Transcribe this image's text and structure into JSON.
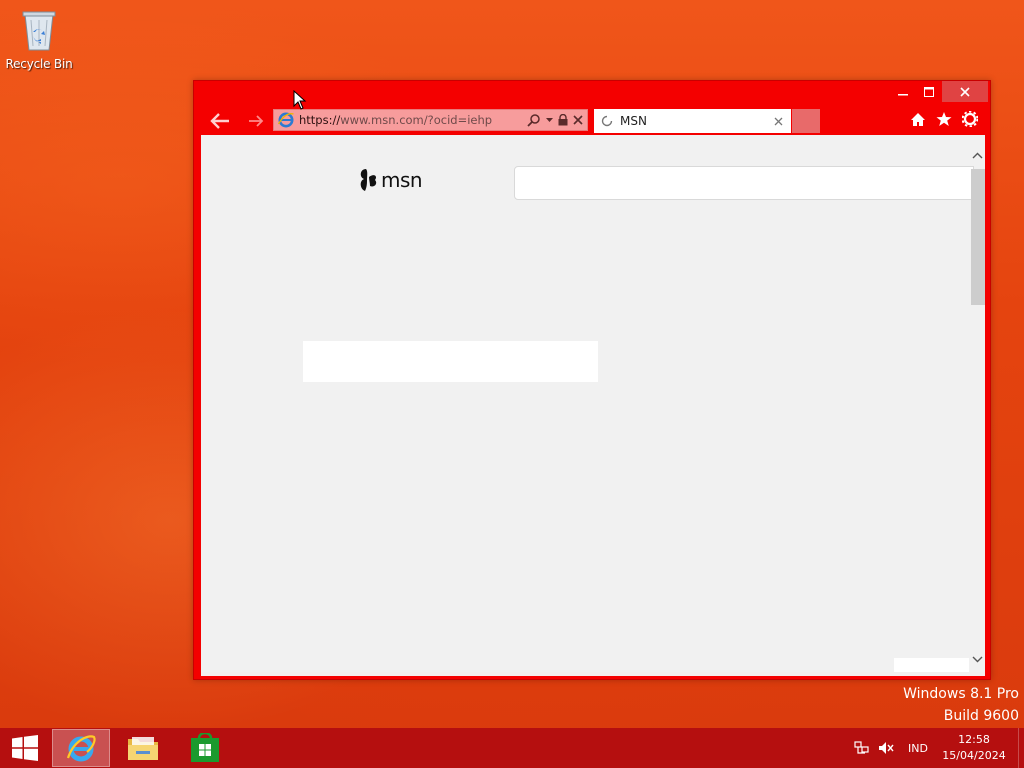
{
  "desktop": {
    "icons": [
      {
        "label": "Recycle Bin",
        "icon": "recycle-bin-icon"
      }
    ]
  },
  "browser": {
    "address_url_prefix": "https://",
    "address_url_host": "www.msn.com",
    "address_url_rest": "/?ocid=iehp",
    "tab_title": "MSN",
    "tab_loading": true,
    "page": {
      "logo_text": "msn",
      "search_value": ""
    }
  },
  "watermark": {
    "line1": "Windows 8.1 Pro",
    "line2": "Build 9600"
  },
  "taskbar": {
    "pinned": [
      "internet-explorer-icon",
      "file-explorer-icon",
      "store-icon"
    ],
    "active": "internet-explorer-icon",
    "tray_lang": "IND",
    "clock_time": "12:58",
    "clock_date": "15/04/2024"
  },
  "colors": {
    "accent": "#f40000",
    "taskbar": "#b50f0f",
    "desktop": "#e8450f"
  }
}
